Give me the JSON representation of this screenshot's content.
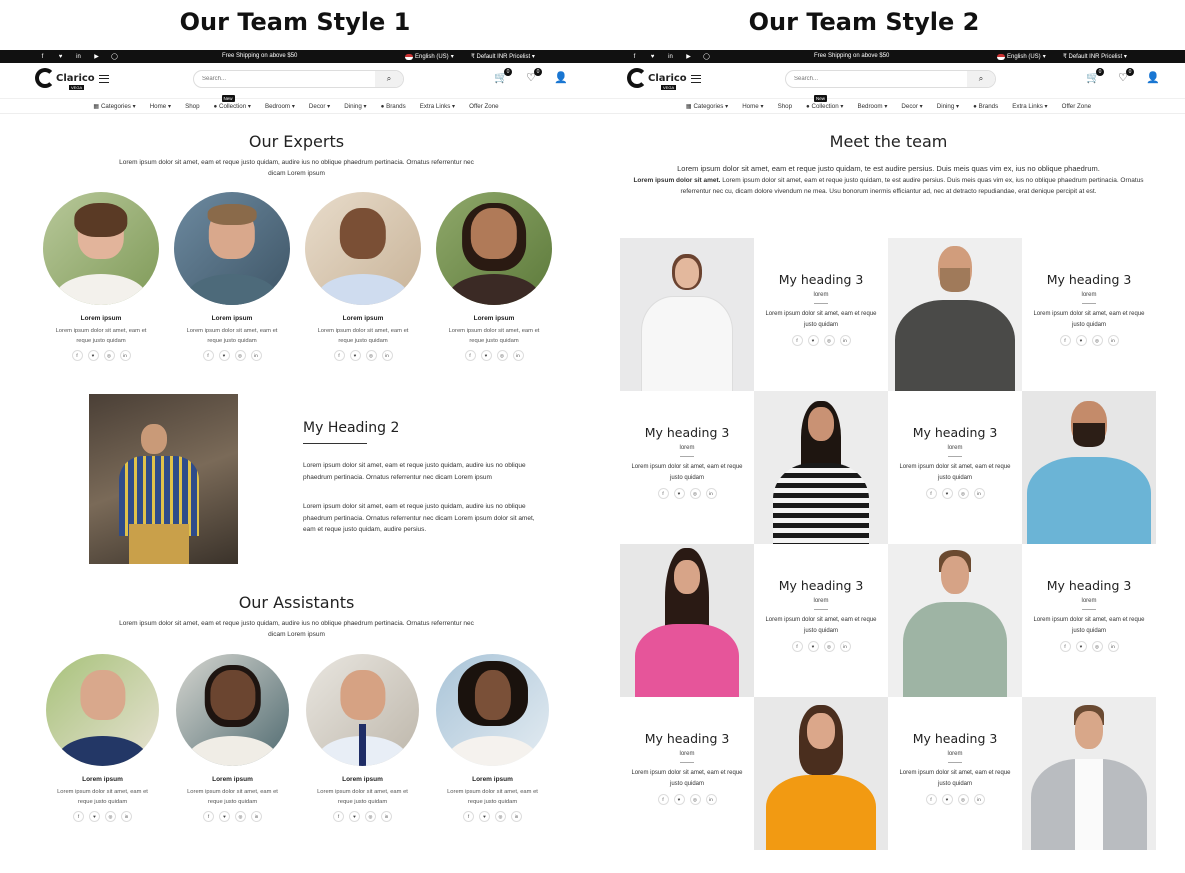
{
  "titles": {
    "style1": "Our Team Style 1",
    "style2": "Our Team Style 2"
  },
  "store": {
    "topbar": {
      "shipping": "Free Shipping on above $50",
      "language": "English (US)",
      "pricelist": "₹ Default INR Pricelist"
    },
    "logo": {
      "name": "Clarico",
      "tag": "VEGA"
    },
    "search_placeholder": "Search...",
    "cart_count": "0",
    "wishlist_count": "0",
    "nav": {
      "categories": "Categories",
      "home": "Home",
      "shop": "Shop",
      "collection": "Collection",
      "new_badge": "New",
      "bedroom": "Bedroom",
      "decor": "Decor",
      "dining": "Dining",
      "brands": "Brands",
      "extra": "Extra Links",
      "offer": "Offer Zone"
    }
  },
  "style1": {
    "experts_title": "Our Experts",
    "experts_desc": "Lorem ipsum dolor sit amet, eam et reque justo quidam, audire ius no oblique phaedrum pertinacia. Ornatus referrentur nec dicam Lorem ipsum",
    "member_name": "Lorem ipsum",
    "member_desc": "Lorem ipsum dolor sit amet, eam et reque justo quidam",
    "heading2": "My Heading 2",
    "para1": "Lorem ipsum dolor sit amet, eam et reque justo quidam, audire ius no oblique phaedrum pertinacia. Ornatus referrentur nec dicam Lorem ipsum",
    "para2": "Lorem ipsum dolor sit amet, eam et reque justo quidam, audire ius no oblique phaedrum pertinacia. Ornatus referrentur nec dicam Lorem ipsum dolor sit amet, eam et reque justo quidam, audire persius.",
    "assistants_title": "Our Assistants",
    "assistants_desc": "Lorem ipsum dolor sit amet, eam et reque justo quidam, audire ius no oblique phaedrum pertinacia. Ornatus referrentur nec dicam Lorem ipsum"
  },
  "style2": {
    "title": "Meet the team",
    "intro": "Lorem ipsum dolor sit amet, eam et reque justo quidam, te est audire persius. Duis meis quas vim ex, ius no oblique phaedrum.",
    "intro_bold": "Lorem ipsum dolor sit amet.",
    "intro_rest": " Lorem ipsum dolor sit amet, eam et reque justo quidam, te est audire persius. Duis meis quas vim ex, ius no oblique phaedrum pertinacia. Ornatus referrentur nec cu, dicam dolore vivendum ne mea. Usu bonorum inermis efficiantur ad, nec at detracto repudiandae, erat denique percipit at est.",
    "card_heading_a": "My heading 3",
    "card_heading_b": "My heading 3",
    "card_sub": "lorem",
    "card_desc": "Lorem ipsum dolor sit amet, eam et reque justo quidam"
  },
  "social": {
    "fb": "f",
    "tw": "♥",
    "ig": "◎",
    "in": "in",
    "yt": "▶",
    "gh": "◯"
  }
}
